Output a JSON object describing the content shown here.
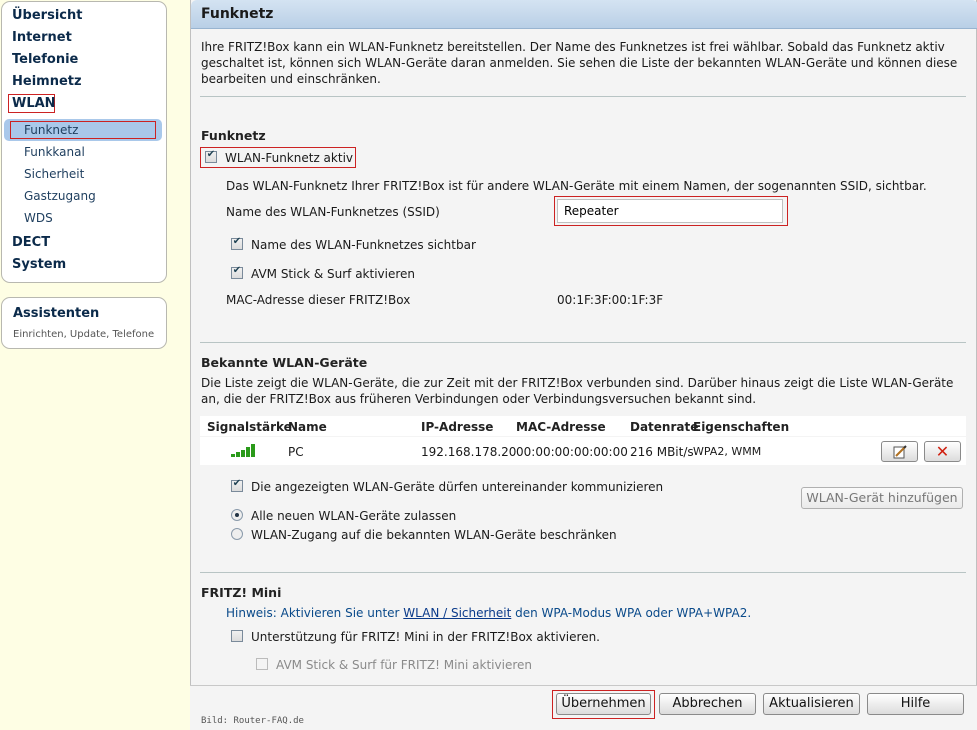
{
  "sidebar": {
    "main_items": [
      "Übersicht",
      "Internet",
      "Telefonie",
      "Heimnetz",
      "WLAN"
    ],
    "wlan_subitems": [
      "Funknetz",
      "Funkkanal",
      "Sicherheit",
      "Gastzugang",
      "WDS"
    ],
    "more_items": [
      "DECT",
      "System"
    ],
    "assistant_title": "Assistenten",
    "assistant_subtitle": "Einrichten, Update, Telefone"
  },
  "page": {
    "title": "Funknetz",
    "intro": "Ihre FRITZ!Box kann ein WLAN-Funknetz bereitstellen. Der Name des Funknetzes ist frei wählbar. Sobald das Funknetz aktiv geschaltet ist, können sich WLAN-Geräte daran anmelden. Sie sehen die Liste der bekannten WLAN-Geräte und können diese bearbeiten und einschränken."
  },
  "funknetz": {
    "heading": "Funknetz",
    "active_label": "WLAN-Funknetz aktiv",
    "active_checked": true,
    "description": "Das WLAN-Funknetz Ihrer FRITZ!Box ist für andere WLAN-Geräte mit einem Namen, der sogenannten SSID, sichtbar.",
    "ssid_label": "Name des WLAN-Funknetzes (SSID)",
    "ssid_value": "Repeater",
    "visible_label": "Name des WLAN-Funknetzes sichtbar",
    "visible_checked": true,
    "stick_label": "AVM Stick & Surf aktivieren",
    "stick_checked": true,
    "mac_label": "MAC-Adresse dieser FRITZ!Box",
    "mac_value": "00:1F:3F:00:1F:3F"
  },
  "devices": {
    "heading": "Bekannte WLAN-Geräte",
    "description": "Die Liste zeigt die WLAN-Geräte, die zur Zeit mit der FRITZ!Box verbunden sind. Darüber hinaus zeigt die Liste WLAN-Geräte an, die der FRITZ!Box aus früheren Verbindungen oder Verbindungsversuchen bekannt sind.",
    "columns": [
      "Signalstärke",
      "Name",
      "IP-Adresse",
      "MAC-Adresse",
      "Datenrate",
      "Eigenschaften"
    ],
    "rows": [
      {
        "signal_bars": 5,
        "name": "PC",
        "ip": "192.168.178.20",
        "mac": "00:00:00:00:00:00",
        "rate": "216 MBit/s",
        "props": "WPA2, WMM"
      }
    ],
    "communicate_label": "Die angezeigten WLAN-Geräte dürfen untereinander kommunizieren",
    "communicate_checked": true,
    "add_button": "WLAN-Gerät hinzufügen",
    "radio_all": "Alle neuen WLAN-Geräte zulassen",
    "radio_known": "WLAN-Zugang auf die bekannten WLAN-Geräte beschränken",
    "selected_radio": "all"
  },
  "mini": {
    "heading": "FRITZ! Mini",
    "hint_prefix": "Hinweis: Aktivieren Sie unter ",
    "hint_link": "WLAN / Sicherheit",
    "hint_suffix": " den WPA-Modus WPA oder WPA+WPA2.",
    "support_label": "Unterstützung für FRITZ! Mini in der FRITZ!Box aktivieren.",
    "support_checked": false,
    "stick_label": "AVM Stick & Surf für FRITZ! Mini aktivieren",
    "stick_checked": false
  },
  "footer": {
    "apply": "Übernehmen",
    "cancel": "Abbrechen",
    "refresh": "Aktualisieren",
    "help": "Hilfe",
    "credit": "Bild: Router-FAQ.de"
  },
  "colors": {
    "accent_red": "#cc2222",
    "nav_blue": "#0b2a4a",
    "signal_green": "#2a9a1a"
  }
}
